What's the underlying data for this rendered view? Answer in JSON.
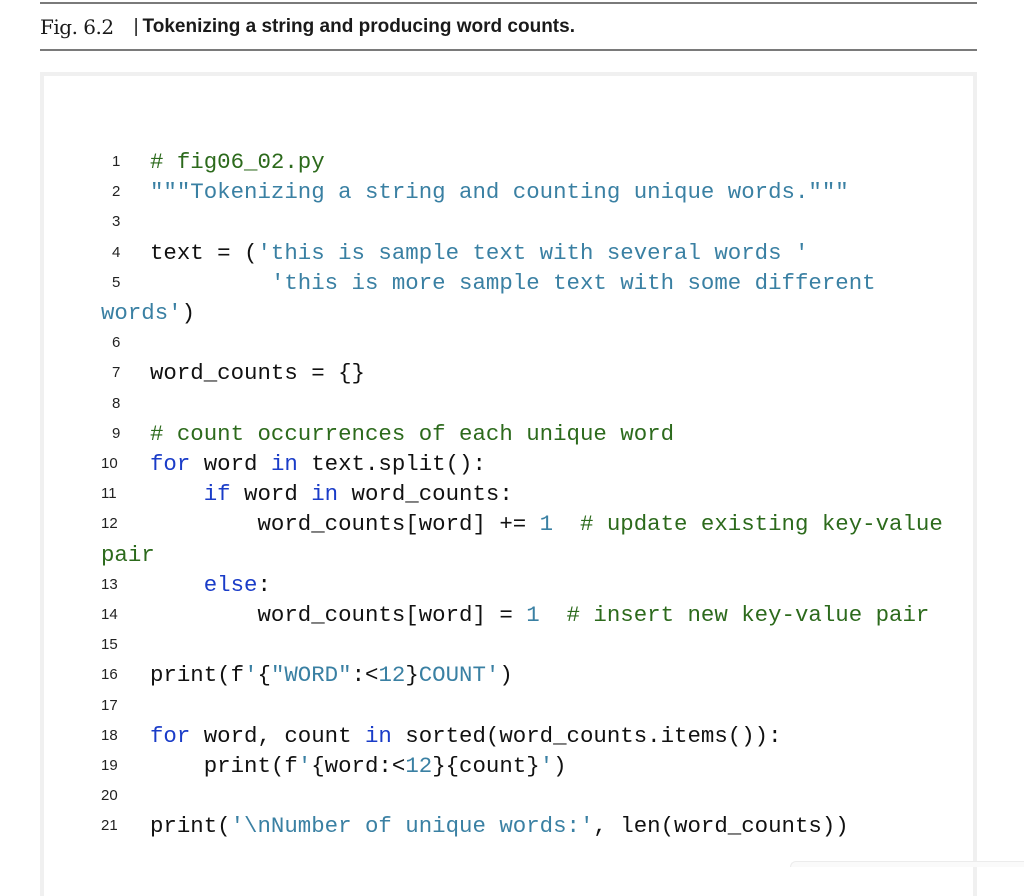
{
  "figure": {
    "number": "Fig. 6.2",
    "title": "Tokenizing a string and producing word counts."
  },
  "code": {
    "filename_comment": "# fig06_02.py",
    "lines": [
      {
        "n": "1",
        "tokens": [
          {
            "t": "# fig06_02.py",
            "k": "comment"
          }
        ]
      },
      {
        "n": "2",
        "tokens": [
          {
            "t": "\"\"\"Tokenizing a string and counting unique words.\"\"\"",
            "k": "string"
          }
        ]
      },
      {
        "n": "3",
        "tokens": []
      },
      {
        "n": "4",
        "tokens": [
          {
            "t": "text = (",
            "k": "plain"
          },
          {
            "t": "'this is sample text with several words '",
            "k": "string"
          }
        ]
      },
      {
        "n": "5",
        "tokens": [
          {
            "t": "         ",
            "k": "plain"
          },
          {
            "t": "'this is more sample text with some different",
            "k": "string"
          }
        ],
        "wrap": [
          {
            "t": "words'",
            "k": "string"
          },
          {
            "t": ")",
            "k": "plain"
          }
        ]
      },
      {
        "n": "6",
        "tokens": []
      },
      {
        "n": "7",
        "tokens": [
          {
            "t": "word_counts = {}",
            "k": "plain"
          }
        ]
      },
      {
        "n": "8",
        "tokens": []
      },
      {
        "n": "9",
        "tokens": [
          {
            "t": "# count occurrences of each unique word",
            "k": "comment"
          }
        ]
      },
      {
        "n": "10",
        "tokens": [
          {
            "t": "for",
            "k": "kw"
          },
          {
            "t": " word ",
            "k": "plain"
          },
          {
            "t": "in",
            "k": "kw"
          },
          {
            "t": " text.split():",
            "k": "plain"
          }
        ]
      },
      {
        "n": "11",
        "tokens": [
          {
            "t": "    ",
            "k": "plain"
          },
          {
            "t": "if",
            "k": "kw"
          },
          {
            "t": " word ",
            "k": "plain"
          },
          {
            "t": "in",
            "k": "kw"
          },
          {
            "t": " word_counts:",
            "k": "plain"
          }
        ]
      },
      {
        "n": "12",
        "tokens": [
          {
            "t": "        word_counts[word] += ",
            "k": "plain"
          },
          {
            "t": "1",
            "k": "num"
          },
          {
            "t": "  ",
            "k": "plain"
          },
          {
            "t": "# update existing key-value",
            "k": "comment"
          }
        ],
        "wrap": [
          {
            "t": "pair",
            "k": "comment"
          }
        ]
      },
      {
        "n": "13",
        "tokens": [
          {
            "t": "    ",
            "k": "plain"
          },
          {
            "t": "else",
            "k": "kw"
          },
          {
            "t": ":",
            "k": "plain"
          }
        ]
      },
      {
        "n": "14",
        "tokens": [
          {
            "t": "        word_counts[word] = ",
            "k": "plain"
          },
          {
            "t": "1",
            "k": "num"
          },
          {
            "t": "  ",
            "k": "plain"
          },
          {
            "t": "# insert new key-value pair",
            "k": "comment"
          }
        ]
      },
      {
        "n": "15",
        "tokens": []
      },
      {
        "n": "16",
        "tokens": [
          {
            "t": "print(f",
            "k": "plain"
          },
          {
            "t": "'",
            "k": "string"
          },
          {
            "t": "{",
            "k": "plain"
          },
          {
            "t": "\"WORD\"",
            "k": "string"
          },
          {
            "t": ":<",
            "k": "plain"
          },
          {
            "t": "12",
            "k": "num"
          },
          {
            "t": "}",
            "k": "plain"
          },
          {
            "t": "COUNT'",
            "k": "string"
          },
          {
            "t": ")",
            "k": "plain"
          }
        ]
      },
      {
        "n": "17",
        "tokens": []
      },
      {
        "n": "18",
        "tokens": [
          {
            "t": "for",
            "k": "kw"
          },
          {
            "t": " word, count ",
            "k": "plain"
          },
          {
            "t": "in",
            "k": "kw"
          },
          {
            "t": " sorted(word_counts.items()):",
            "k": "plain"
          }
        ]
      },
      {
        "n": "19",
        "tokens": [
          {
            "t": "    print(f",
            "k": "plain"
          },
          {
            "t": "'",
            "k": "string"
          },
          {
            "t": "{word:<",
            "k": "plain"
          },
          {
            "t": "12",
            "k": "num"
          },
          {
            "t": "}{count}",
            "k": "plain"
          },
          {
            "t": "'",
            "k": "string"
          },
          {
            "t": ")",
            "k": "plain"
          }
        ]
      },
      {
        "n": "20",
        "tokens": []
      },
      {
        "n": "21",
        "tokens": [
          {
            "t": "print(",
            "k": "plain"
          },
          {
            "t": "'\\nNumber of unique words:'",
            "k": "string"
          },
          {
            "t": ", len(word_counts))",
            "k": "plain"
          }
        ]
      }
    ]
  },
  "colors": {
    "comment": "#2c6a1c",
    "string": "#3a80a3",
    "keyword": "#1a3cc8",
    "number": "#3a80a3",
    "plain": "#111111"
  }
}
